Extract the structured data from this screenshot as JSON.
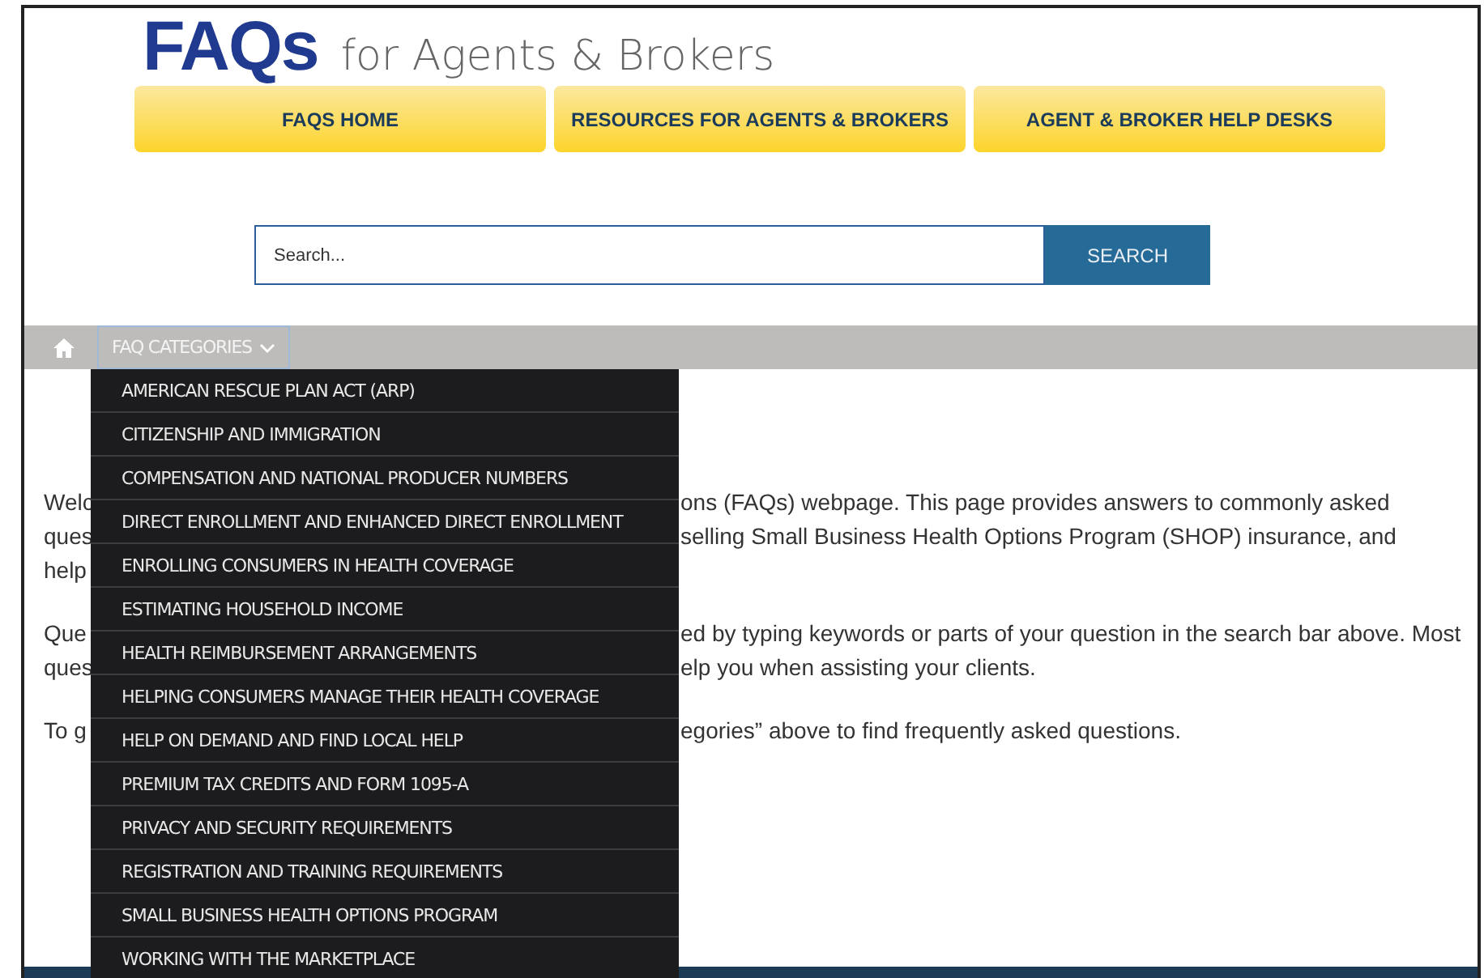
{
  "logo": {
    "mark": "FAQs",
    "tagline": "for Agents & Brokers"
  },
  "nav": [
    "FAQS HOME",
    "RESOURCES FOR AGENTS & BROKERS",
    "AGENT & BROKER HELP DESKS"
  ],
  "search": {
    "placeholder": "Search...",
    "button": "SEARCH"
  },
  "breadcrumb": {
    "menu_label": "FAQ CATEGORIES",
    "expanded": true,
    "categories": [
      "AMERICAN RESCUE PLAN ACT (ARP)",
      "CITIZENSHIP AND IMMIGRATION",
      "COMPENSATION AND NATIONAL PRODUCER NUMBERS",
      "DIRECT ENROLLMENT AND ENHANCED DIRECT ENROLLMENT",
      "ENROLLING CONSUMERS IN HEALTH COVERAGE",
      "ESTIMATING HOUSEHOLD INCOME",
      "HEALTH REIMBURSEMENT ARRANGEMENTS",
      "HELPING CONSUMERS MANAGE THEIR HEALTH COVERAGE",
      "HELP ON DEMAND AND FIND LOCAL HELP",
      "PREMIUM TAX CREDITS AND FORM 1095-A",
      "PRIVACY AND SECURITY REQUIREMENTS",
      "REGISTRATION AND TRAINING REQUIREMENTS",
      "SMALL BUSINESS HEALTH OPTIONS PROGRAM",
      "WORKING WITH THE MARKETPLACE"
    ]
  },
  "paragraphs": [
    {
      "lines": [
        {
          "left": "Welc",
          "right": "ons (FAQs) webpage. This page provides answers to commonly asked"
        },
        {
          "left": "ques",
          "right": "selling Small Business Health Options Program (SHOP) insurance, and"
        },
        {
          "left": "help"
        }
      ]
    },
    {
      "lines": [
        {
          "left": "Que",
          "right": "ed by typing keywords or parts of your question in the search bar above. Most"
        },
        {
          "left": "ques",
          "right": "elp you when assisting your clients."
        }
      ]
    },
    {
      "lines": [
        {
          "left": "To g",
          "right": "egories” above to find frequently asked questions."
        }
      ]
    }
  ]
}
